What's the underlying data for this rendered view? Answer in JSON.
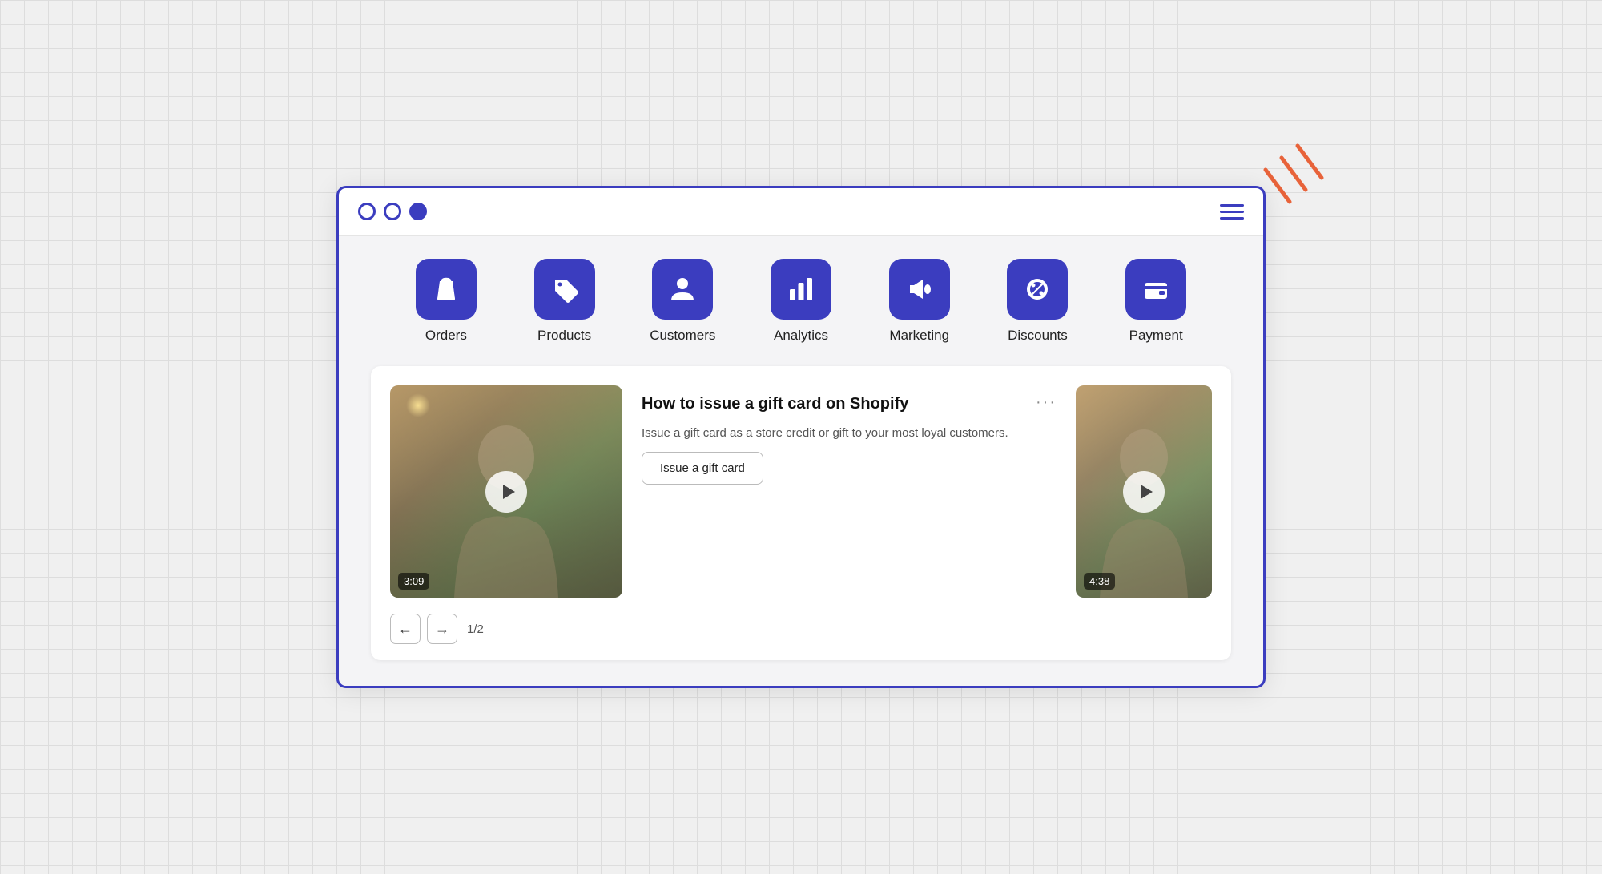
{
  "browser": {
    "dots": [
      "empty",
      "empty",
      "filled"
    ],
    "hamburger_label": "menu"
  },
  "nav": {
    "items": [
      {
        "id": "orders",
        "label": "Orders",
        "icon": "shopping-bag"
      },
      {
        "id": "products",
        "label": "Products",
        "icon": "tag"
      },
      {
        "id": "customers",
        "label": "Customers",
        "icon": "person"
      },
      {
        "id": "analytics",
        "label": "Analytics",
        "icon": "bar-chart"
      },
      {
        "id": "marketing",
        "label": "Marketing",
        "icon": "megaphone"
      },
      {
        "id": "discounts",
        "label": "Discounts",
        "icon": "percent"
      },
      {
        "id": "payment",
        "label": "Payment",
        "icon": "wallet"
      }
    ]
  },
  "video_card": {
    "title": "How to issue a gift card on Shopify",
    "description": "Issue a gift card as a store credit or gift to your most loyal customers.",
    "cta_label": "Issue a gift card",
    "duration_1": "3:09",
    "duration_2": "4:38",
    "more_icon": "···",
    "pagination": {
      "prev_label": "←",
      "next_label": "→",
      "count": "1/2"
    }
  }
}
